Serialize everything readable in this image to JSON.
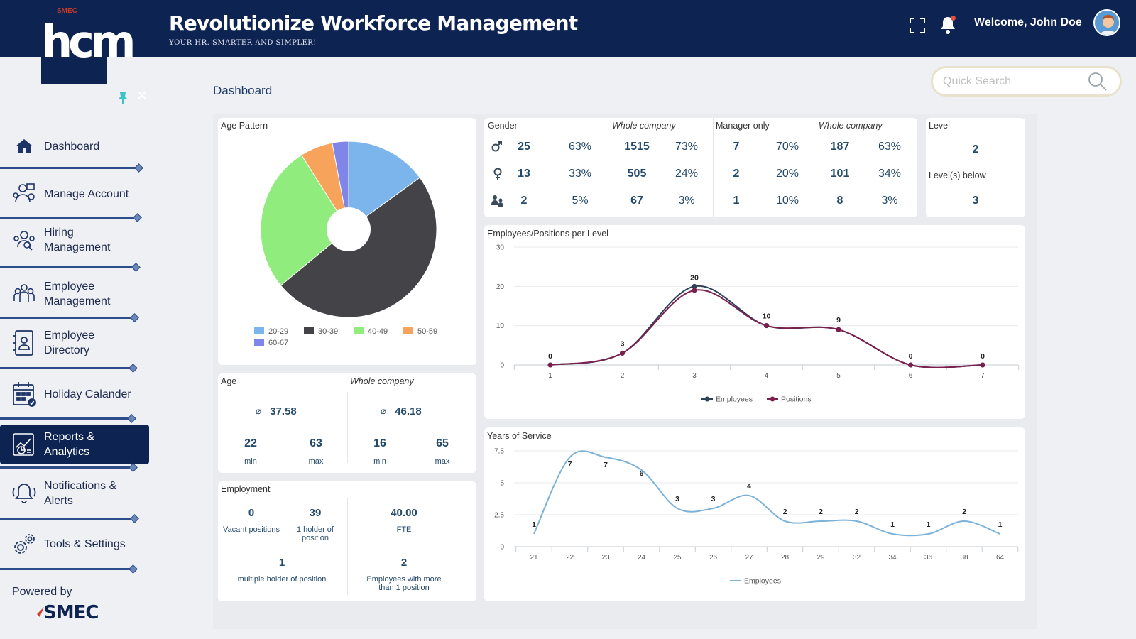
{
  "header": {
    "logo_text": "hcm",
    "logo_small": "SMEC",
    "title": "Revolutionize Workforce Management",
    "subtitle": "YOUR HR. SMARTER AND SIMPLER!",
    "welcome": "Welcome, John Doe"
  },
  "sidebar": {
    "items": [
      {
        "label": "Dashboard",
        "icon": "home-icon"
      },
      {
        "label": "Manage Account",
        "icon": "manage-account-icon"
      },
      {
        "label": "Hiring Management",
        "icon": "hiring-icon"
      },
      {
        "label": "Employee Management",
        "icon": "employee-management-icon"
      },
      {
        "label": "Employee Directory",
        "icon": "directory-icon"
      },
      {
        "label": "Holiday Calander",
        "icon": "calendar-icon"
      },
      {
        "label": "Reports & Analytics",
        "icon": "reports-icon",
        "active": true
      },
      {
        "label": "Notifications & Alerts",
        "icon": "bell-icon"
      },
      {
        "label": "Tools & Settings",
        "icon": "gear-icon"
      }
    ],
    "powered_by": "Powered by",
    "brand": "SMEC"
  },
  "page": {
    "title": "Dashboard",
    "search_placeholder": "Quick Search"
  },
  "age_pattern": {
    "title": "Age Pattern",
    "legend": [
      "20-29",
      "30-39",
      "40-49",
      "50-59",
      "60-67"
    ]
  },
  "gender": {
    "title": "Gender",
    "whole_company": "Whole company",
    "manager_only": "Manager only",
    "whole_company_2": "Whole company",
    "rows": [
      {
        "icon": "male-icon",
        "c1": "25",
        "c2": "63%",
        "c3": "1515",
        "c4": "73%",
        "c5": "7",
        "c6": "70%",
        "c7": "187",
        "c8": "63%"
      },
      {
        "icon": "female-icon",
        "c1": "13",
        "c2": "33%",
        "c3": "505",
        "c4": "24%",
        "c5": "2",
        "c6": "20%",
        "c7": "101",
        "c8": "34%"
      },
      {
        "icon": "group-icon",
        "c1": "2",
        "c2": "5%",
        "c3": "67",
        "c4": "3%",
        "c5": "1",
        "c6": "10%",
        "c7": "8",
        "c8": "3%"
      }
    ]
  },
  "level": {
    "title": "Level",
    "value": "2",
    "below_label": "Level(s) below",
    "below_value": "3"
  },
  "age": {
    "title": "Age",
    "whole_company": "Whole company",
    "avg": "37.58",
    "avg_symbol": "⌀",
    "min": "22",
    "max": "63",
    "wc_avg": "46.18",
    "wc_min": "16",
    "wc_max": "65",
    "min_label": "min",
    "max_label": "max"
  },
  "employment": {
    "title": "Employment",
    "vacant": "0",
    "vacant_label": "Vacant positions",
    "holder": "39",
    "holder_label": "1 holder of position",
    "fte": "40.00",
    "fte_label": "FTE",
    "multi": "1",
    "multi_label": "multiple holder of position",
    "more": "2",
    "more_label": "Employees with more than 1 position"
  },
  "chart_data": [
    {
      "type": "pie",
      "title": "Age Pattern",
      "categories": [
        "20-29",
        "30-39",
        "40-49",
        "50-59",
        "60-67"
      ],
      "values": [
        15,
        49,
        27,
        6,
        3
      ],
      "colors": [
        "#7cb5ec",
        "#434348",
        "#90ed7d",
        "#f7a35c",
        "#8085e9"
      ],
      "donut": true,
      "legend": "bottom"
    },
    {
      "type": "line",
      "title": "Employees/Positions per Level",
      "x": [
        "1",
        "2",
        "3",
        "4",
        "5",
        "6",
        "7"
      ],
      "series": [
        {
          "name": "Employees",
          "values": [
            0,
            3,
            20,
            10,
            9,
            0,
            0
          ],
          "color": "#2e4157"
        },
        {
          "name": "Positions",
          "values": [
            0,
            3,
            19,
            10,
            9,
            0,
            0
          ],
          "color": "#7b1f4f"
        }
      ],
      "data_labels": [
        0,
        3,
        20,
        10,
        9,
        0,
        0
      ],
      "ylim": [
        0,
        30
      ],
      "yticks": [
        0,
        10,
        20,
        30
      ],
      "grid": true,
      "legend": "bottom"
    },
    {
      "type": "line",
      "title": "Years of Service",
      "x": [
        "21",
        "22",
        "23",
        "24",
        "25",
        "26",
        "27",
        "28",
        "29",
        "32",
        "34",
        "36",
        "38",
        "64"
      ],
      "series": [
        {
          "name": "Employees",
          "values": [
            1,
            7,
            7,
            6,
            3,
            3,
            4,
            2,
            2,
            2,
            1,
            1,
            2,
            1
          ],
          "color": "#7ab2da"
        }
      ],
      "ylim": [
        0,
        7.5
      ],
      "yticks": [
        "0",
        "2.5",
        "5",
        "7.5"
      ],
      "grid": true,
      "legend": "bottom"
    }
  ]
}
